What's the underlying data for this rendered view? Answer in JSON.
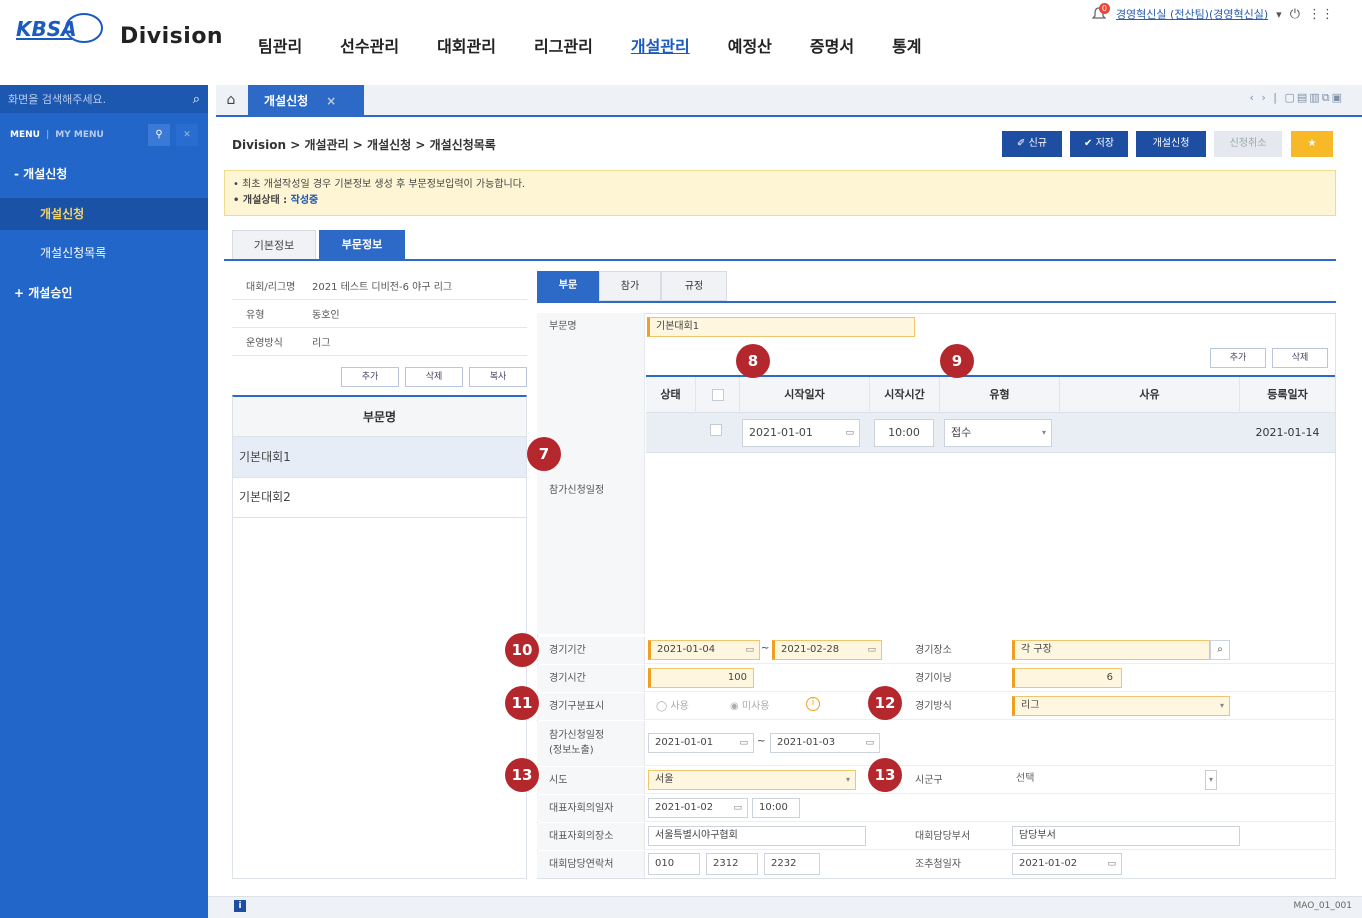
{
  "header": {
    "logo_text": "KBSA",
    "division": "Division",
    "nav": [
      "팀관리",
      "선수관리",
      "대회관리",
      "리그관리",
      "개설관리",
      "예정산",
      "증명서",
      "통계"
    ],
    "nav_active": "개설관리",
    "notification_count": "0",
    "user": "경영혁신실 (전산팀)(경영혁신실)"
  },
  "sidebar": {
    "search_placeholder": "화면을 검색해주세요.",
    "menu_label": "MENU",
    "my_menu_label": "MY MENU",
    "items": [
      {
        "label": "- 개설신청"
      },
      {
        "label": "개설신청"
      },
      {
        "label": "개설신청목록"
      },
      {
        "label": "+ 개설승인"
      }
    ]
  },
  "tabs": {
    "open_tab": "개설신청",
    "close": "×"
  },
  "breadcrumb": "Division > 개설관리 > 개설신청 > 개설신청목록",
  "toolbar": {
    "new": "✐ 신규",
    "save": "✔ 저장",
    "apply": "개설신청",
    "cancel": "신청취소",
    "star": "★"
  },
  "notice": {
    "line1": "• 최초 개설작성일 경우 기본정보 생성 후 부문정보입력이 가능합니다.",
    "status_label": "• 개설상태 : ",
    "status_value": "작성중"
  },
  "subtabs": [
    "기본정보",
    "부문정보"
  ],
  "left_info": [
    {
      "k": "대회/리그명",
      "v": "2021 테스트 디비전-6 야구 리그"
    },
    {
      "k": "유형",
      "v": "동호인"
    },
    {
      "k": "운영방식",
      "v": "리그"
    }
  ],
  "left_buttons": [
    "추가",
    "삭제",
    "복사"
  ],
  "division_list": {
    "header": "부문명",
    "rows": [
      "기본대회1",
      "기본대회2"
    ]
  },
  "right_tabs": [
    "부문",
    "참가",
    "규정"
  ],
  "form": {
    "division_name_label": "부문명",
    "division_name_value": "기본대회1",
    "schedule_label": "참가신청일정",
    "grid_buttons": [
      "추가",
      "삭제"
    ],
    "grid_headers": [
      "상태",
      "",
      "시작일자",
      "시작시간",
      "유형",
      "사유",
      "등록일자"
    ],
    "grid_row": {
      "status": "",
      "start_date": "2021-01-01",
      "start_time": "10:00",
      "type": "접수",
      "reason": "",
      "reg_date": "2021-01-14"
    },
    "period_label": "경기기간",
    "period_from": "2021-01-04",
    "period_to": "2021-02-28",
    "venue_label": "경기장소",
    "venue_value": "각 구장",
    "time_label": "경기시간",
    "time_value": "100",
    "innings_label": "경기이닝",
    "innings_value": "6",
    "display_label": "경기구분표시",
    "display_use": "사용",
    "display_unused": "미사용",
    "method_label": "경기방식",
    "method_value": "리그",
    "apply_period_label": "참가신청일정",
    "apply_period_label2": "(정보노출)",
    "apply_from": "2021-01-01",
    "apply_to": "2021-01-03",
    "sido_label": "시도",
    "sido_value": "서울",
    "sigungu_label": "시군구",
    "sigungu_value": "선택",
    "rep_meeting_date_label": "대표자회의일자",
    "rep_meeting_date": "2021-01-02",
    "rep_meeting_time": "10:00",
    "rep_meeting_place_label": "대표자회의장소",
    "rep_meeting_place": "서울특별시야구협회",
    "dept_label": "대회담당부서",
    "dept_value": "담당부서",
    "contact_label": "대회담당연락처",
    "contact": [
      "010",
      "2312",
      "2232"
    ],
    "draw_date_label": "조추첨일자",
    "draw_date": "2021-01-02"
  },
  "markers": [
    "7",
    "8",
    "9",
    "10",
    "11",
    "12",
    "13",
    "13"
  ],
  "footer": {
    "code": "MAO_01_001",
    "info": "i"
  }
}
